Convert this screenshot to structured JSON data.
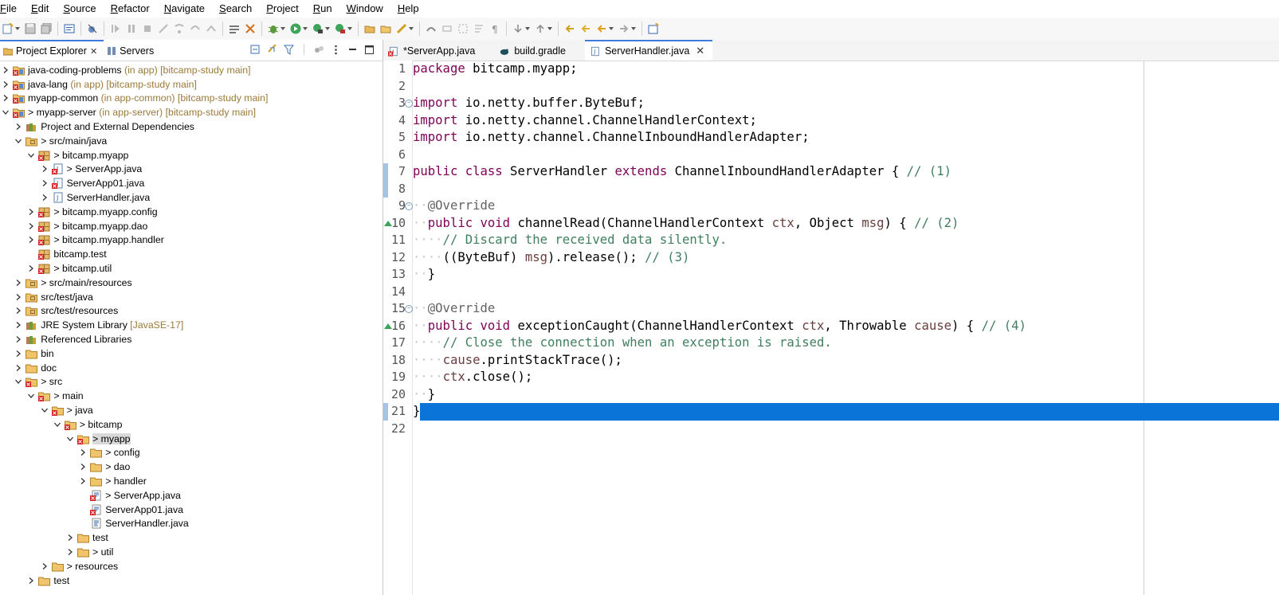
{
  "menu": [
    "File",
    "Edit",
    "Source",
    "Refactor",
    "Navigate",
    "Search",
    "Project",
    "Run",
    "Window",
    "Help"
  ],
  "left_tabs": [
    {
      "label": "Project Explorer",
      "icon": "project-explorer-icon",
      "active": true
    },
    {
      "label": "Servers",
      "icon": "servers-icon",
      "active": false
    }
  ],
  "tree": [
    {
      "depth": 0,
      "exp": "closed",
      "icon": "project-icon",
      "label": "java-coding-problems",
      "decor": " (in app) [bitcamp-study main]"
    },
    {
      "depth": 0,
      "exp": "closed",
      "icon": "project-icon",
      "label": "java-lang",
      "decor": " (in app) [bitcamp-study main]"
    },
    {
      "depth": 0,
      "exp": "closed",
      "icon": "project-icon",
      "label": "myapp-common",
      "decor": " (in app-common) [bitcamp-study main]"
    },
    {
      "depth": 0,
      "exp": "open",
      "icon": "project-icon",
      "label": "> myapp-server",
      "decor": " (in app-server) [bitcamp-study main]"
    },
    {
      "depth": 1,
      "exp": "closed",
      "icon": "library-icon",
      "label": "Project and External Dependencies",
      "decor": ""
    },
    {
      "depth": 1,
      "exp": "open",
      "icon": "source-folder-icon",
      "label": "> src/main/java",
      "decor": ""
    },
    {
      "depth": 2,
      "exp": "open",
      "icon": "package-icon",
      "label": "> bitcamp.myapp",
      "decor": ""
    },
    {
      "depth": 3,
      "exp": "closed",
      "icon": "java-file-error-icon",
      "label": "> ServerApp.java",
      "decor": ""
    },
    {
      "depth": 3,
      "exp": "closed",
      "icon": "java-file-error-icon",
      "label": "ServerApp01.java",
      "decor": ""
    },
    {
      "depth": 3,
      "exp": "closed",
      "icon": "java-file-icon",
      "label": "ServerHandler.java",
      "decor": ""
    },
    {
      "depth": 2,
      "exp": "closed",
      "icon": "package-icon",
      "label": "> bitcamp.myapp.config",
      "decor": ""
    },
    {
      "depth": 2,
      "exp": "closed",
      "icon": "package-icon",
      "label": "> bitcamp.myapp.dao",
      "decor": ""
    },
    {
      "depth": 2,
      "exp": "closed",
      "icon": "package-icon",
      "label": "> bitcamp.myapp.handler",
      "decor": ""
    },
    {
      "depth": 2,
      "exp": "none",
      "icon": "package-icon",
      "label": "bitcamp.test",
      "decor": ""
    },
    {
      "depth": 2,
      "exp": "closed",
      "icon": "package-icon",
      "label": "> bitcamp.util",
      "decor": ""
    },
    {
      "depth": 1,
      "exp": "closed",
      "icon": "source-folder-icon",
      "label": "> src/main/resources",
      "decor": ""
    },
    {
      "depth": 1,
      "exp": "closed",
      "icon": "source-folder-icon",
      "label": "src/test/java",
      "decor": ""
    },
    {
      "depth": 1,
      "exp": "closed",
      "icon": "source-folder-icon",
      "label": "src/test/resources",
      "decor": ""
    },
    {
      "depth": 1,
      "exp": "closed",
      "icon": "library-icon",
      "label": "JRE System Library",
      "decor": " [JavaSE-17]"
    },
    {
      "depth": 1,
      "exp": "closed",
      "icon": "library-icon",
      "label": "Referenced Libraries",
      "decor": ""
    },
    {
      "depth": 1,
      "exp": "closed",
      "icon": "folder-icon",
      "label": "bin",
      "decor": ""
    },
    {
      "depth": 1,
      "exp": "closed",
      "icon": "folder-icon",
      "label": "doc",
      "decor": ""
    },
    {
      "depth": 1,
      "exp": "open",
      "icon": "folder-error-icon",
      "label": "> src",
      "decor": ""
    },
    {
      "depth": 2,
      "exp": "open",
      "icon": "folder-error-icon",
      "label": "> main",
      "decor": ""
    },
    {
      "depth": 3,
      "exp": "open",
      "icon": "folder-error-icon",
      "label": "> java",
      "decor": ""
    },
    {
      "depth": 4,
      "exp": "open",
      "icon": "folder-error-icon",
      "label": "> bitcamp",
      "decor": ""
    },
    {
      "depth": 5,
      "exp": "open",
      "icon": "folder-error-icon",
      "label": "> myapp",
      "decor": "",
      "selected": true
    },
    {
      "depth": 6,
      "exp": "closed",
      "icon": "folder-icon",
      "label": "> config",
      "decor": ""
    },
    {
      "depth": 6,
      "exp": "closed",
      "icon": "folder-icon",
      "label": "> dao",
      "decor": ""
    },
    {
      "depth": 6,
      "exp": "closed",
      "icon": "folder-icon",
      "label": "> handler",
      "decor": ""
    },
    {
      "depth": 6,
      "exp": "none",
      "icon": "file-error-icon",
      "label": "> ServerApp.java",
      "decor": ""
    },
    {
      "depth": 6,
      "exp": "none",
      "icon": "file-error-icon",
      "label": "ServerApp01.java",
      "decor": ""
    },
    {
      "depth": 6,
      "exp": "none",
      "icon": "file-icon",
      "label": "ServerHandler.java",
      "decor": ""
    },
    {
      "depth": 5,
      "exp": "closed",
      "icon": "folder-icon",
      "label": "test",
      "decor": ""
    },
    {
      "depth": 5,
      "exp": "closed",
      "icon": "folder-icon",
      "label": "> util",
      "decor": ""
    },
    {
      "depth": 3,
      "exp": "closed",
      "icon": "folder-icon",
      "label": "> resources",
      "decor": ""
    },
    {
      "depth": 2,
      "exp": "closed",
      "icon": "folder-icon",
      "label": "test",
      "decor": ""
    }
  ],
  "editor_tabs": [
    {
      "label": "*ServerApp.java",
      "icon": "java-file-error-icon",
      "active": false
    },
    {
      "label": "build.gradle",
      "icon": "gradle-icon",
      "active": false
    },
    {
      "label": "ServerHandler.java",
      "icon": "java-file-icon",
      "active": true
    }
  ],
  "code": [
    [
      [
        "kw",
        "package"
      ],
      [
        "t",
        " bitcamp.myapp;"
      ]
    ],
    [],
    [
      [
        "kw",
        "import"
      ],
      [
        "t",
        " io.netty.buffer.ByteBuf;"
      ]
    ],
    [
      [
        "kw",
        "import"
      ],
      [
        "t",
        " io.netty.channel.ChannelHandlerContext;"
      ]
    ],
    [
      [
        "kw",
        "import"
      ],
      [
        "t",
        " io.netty.channel.ChannelInboundHandlerAdapter;"
      ]
    ],
    [],
    [
      [
        "kw",
        "public class"
      ],
      [
        "t",
        " ServerHandler "
      ],
      [
        "kw",
        "extends"
      ],
      [
        "t",
        " ChannelInboundHandlerAdapter { "
      ],
      [
        "cm",
        "// (1)"
      ]
    ],
    [],
    [
      [
        "ws",
        "··"
      ],
      [
        "an",
        "@Override"
      ]
    ],
    [
      [
        "ws",
        "··"
      ],
      [
        "kw",
        "public void"
      ],
      [
        "t",
        " channelRead(ChannelHandlerContext "
      ],
      [
        "pm",
        "ctx"
      ],
      [
        "t",
        ", Object "
      ],
      [
        "pm",
        "msg"
      ],
      [
        "t",
        ") { "
      ],
      [
        "cm",
        "// (2)"
      ]
    ],
    [
      [
        "ws",
        "····"
      ],
      [
        "cm",
        "// Discard the received data silently."
      ]
    ],
    [
      [
        "ws",
        "····"
      ],
      [
        "t",
        "((ByteBuf) "
      ],
      [
        "pm",
        "msg"
      ],
      [
        "t",
        ").release(); "
      ],
      [
        "cm",
        "// (3)"
      ]
    ],
    [
      [
        "ws",
        "··"
      ],
      [
        "t",
        "}"
      ]
    ],
    [],
    [
      [
        "ws",
        "··"
      ],
      [
        "an",
        "@Override"
      ]
    ],
    [
      [
        "ws",
        "··"
      ],
      [
        "kw",
        "public void"
      ],
      [
        "t",
        " exceptionCaught(ChannelHandlerContext "
      ],
      [
        "pm",
        "ctx"
      ],
      [
        "t",
        ", Throwable "
      ],
      [
        "pm",
        "cause"
      ],
      [
        "t",
        ") { "
      ],
      [
        "cm",
        "// (4)"
      ]
    ],
    [
      [
        "ws",
        "····"
      ],
      [
        "cm",
        "// Close the connection when an exception is raised."
      ]
    ],
    [
      [
        "ws",
        "····"
      ],
      [
        "pm",
        "cause"
      ],
      [
        "t",
        ".printStackTrace();"
      ]
    ],
    [
      [
        "ws",
        "····"
      ],
      [
        "pm",
        "ctx"
      ],
      [
        "t",
        ".close();"
      ]
    ],
    [
      [
        "ws",
        "··"
      ],
      [
        "t",
        "}"
      ]
    ],
    [
      [
        "t",
        "}"
      ]
    ],
    []
  ],
  "line_numbers": [
    "1",
    "2",
    "3",
    "4",
    "5",
    "6",
    "7",
    "8",
    "9",
    "10",
    "11",
    "12",
    "13",
    "14",
    "15",
    "16",
    "17",
    "18",
    "19",
    "20",
    "21",
    "22"
  ],
  "colors": {
    "keyword": "#7f0055",
    "comment": "#3f7f5f",
    "annotation": "#646464",
    "param": "#6a3e3e",
    "selection": "#0a74d8",
    "accent": "#3b7dd8"
  }
}
